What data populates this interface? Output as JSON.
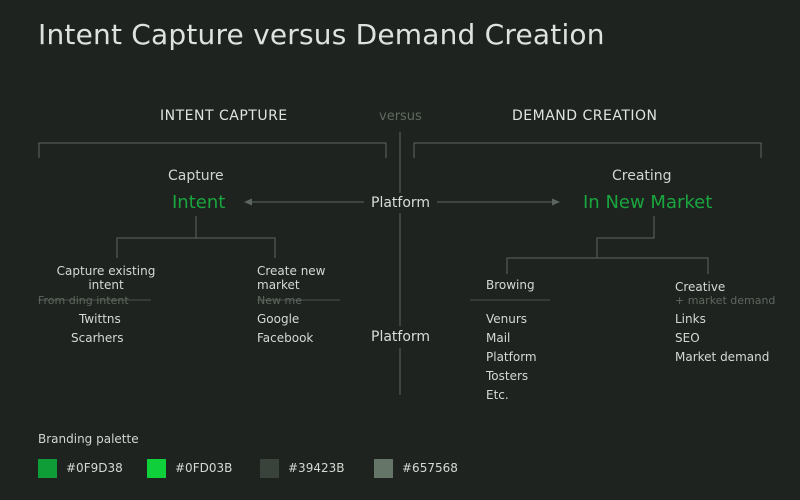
{
  "title": "Intent Capture versus Demand Creation",
  "headers": {
    "left": "INTENT CAPTURE",
    "versus": "versus",
    "right": "DEMAND CREATION"
  },
  "left": {
    "subtitle": "Capture",
    "highlight": "Intent",
    "branch1": {
      "label": "Capture existing intent",
      "note": "From ding intent",
      "items": [
        "Twittns",
        "Scarhers"
      ]
    },
    "branch2": {
      "label": "Create new market",
      "note": "New me",
      "items": [
        "Google",
        "Facebook"
      ]
    }
  },
  "center": {
    "platform_top": "Platform",
    "platform_bottom": "Platform"
  },
  "right": {
    "subtitle": "Creating",
    "highlight": "In New Market",
    "branch1": {
      "label": "Browing",
      "items": [
        "Venurs",
        "Mail",
        "Platform",
        "Tosters",
        "Etc."
      ]
    },
    "branch2": {
      "label": "Creative",
      "note": "+ market demand",
      "items": [
        "Links",
        "SEO",
        "Market demand"
      ]
    }
  },
  "palette": {
    "title": "Branding palette",
    "colors": [
      "#0F9D38",
      "#0FD03B",
      "#39423B",
      "#657568"
    ]
  }
}
